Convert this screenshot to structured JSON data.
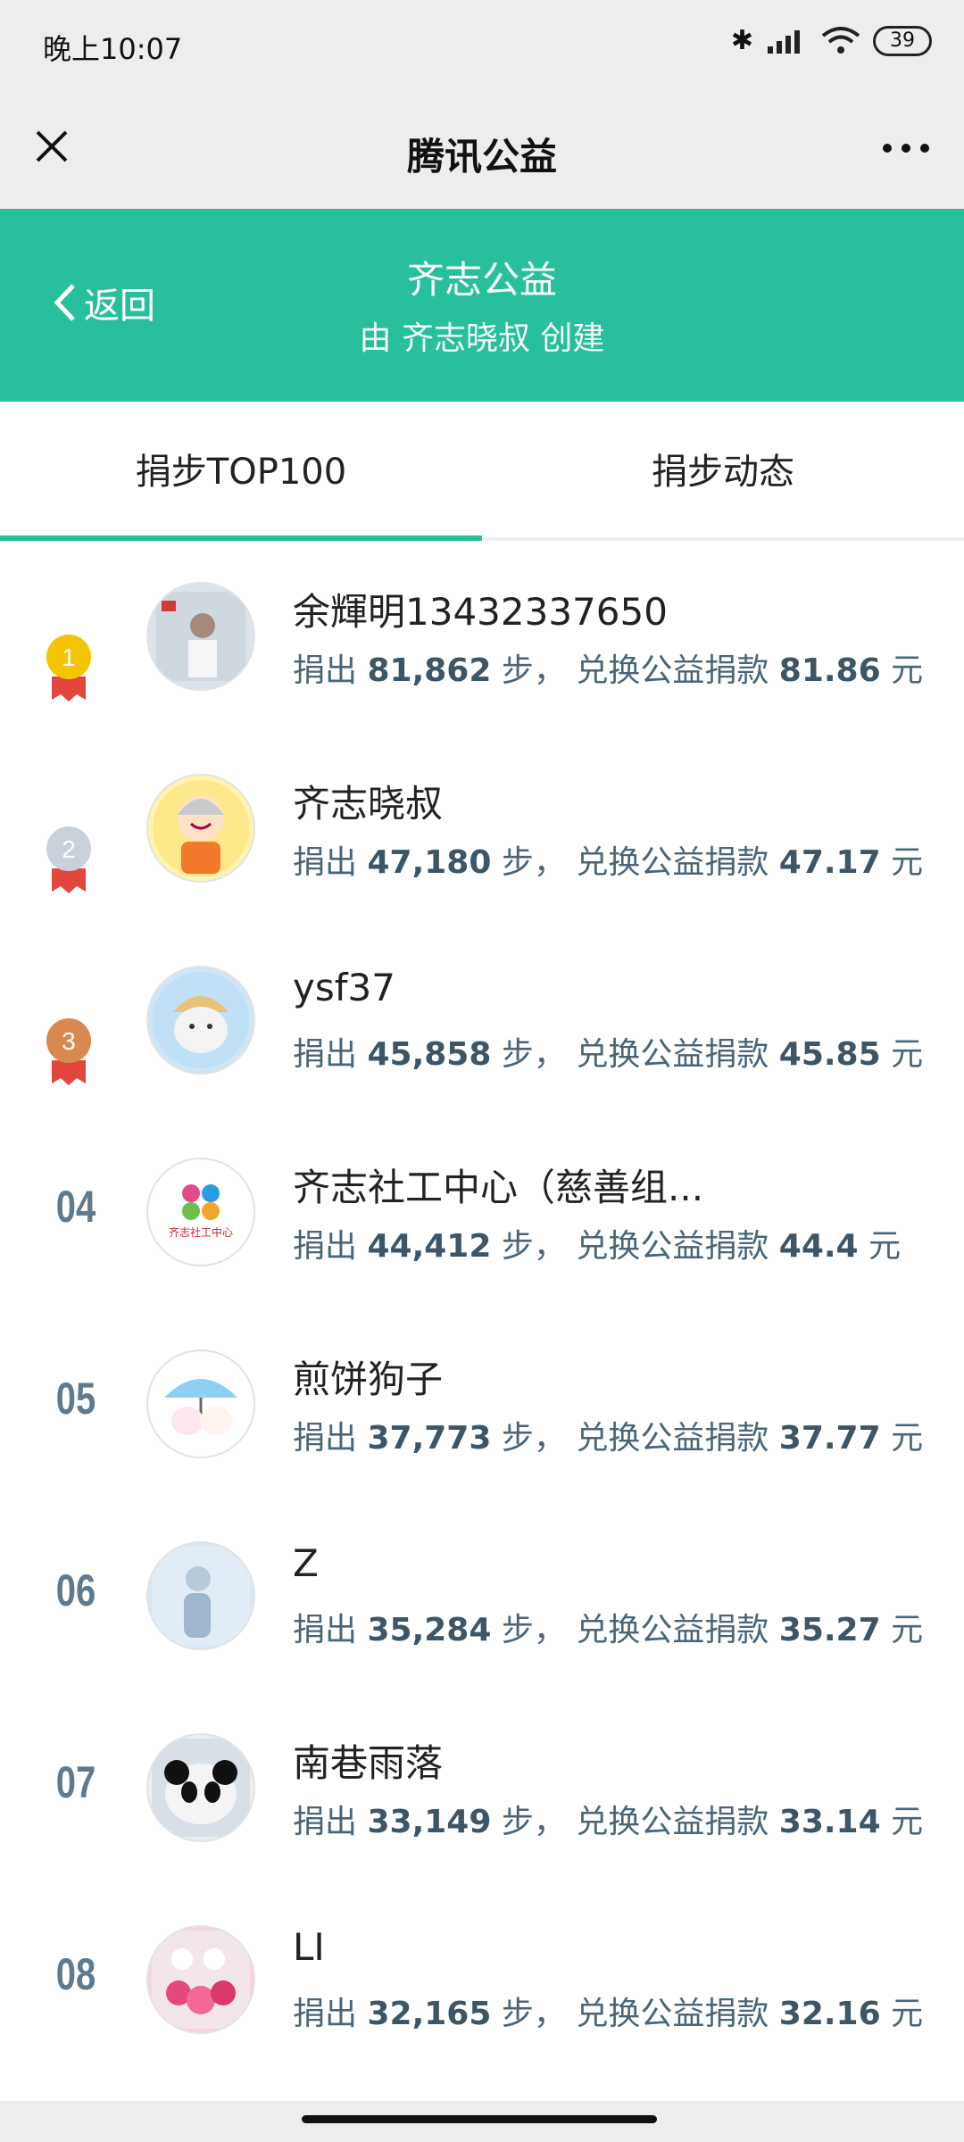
{
  "status": {
    "time": "晚上10:07",
    "battery": "39"
  },
  "titlebar": {
    "title": "腾讯公益"
  },
  "header": {
    "back_label": "返回",
    "org_name": "齐志公益",
    "creator": "由 齐志晓叔 创建"
  },
  "tabs": [
    {
      "label": "捐步TOP100",
      "active": true
    },
    {
      "label": "捐步动态",
      "active": false
    }
  ],
  "ranking": [
    {
      "rank": "1",
      "name": "余輝明13432337650",
      "steps": "81,862",
      "amount": "81.86"
    },
    {
      "rank": "2",
      "name": "齐志晓叔",
      "steps": "47,180",
      "amount": "47.17"
    },
    {
      "rank": "3",
      "name": "ysf37",
      "steps": "45,858",
      "amount": "45.85"
    },
    {
      "rank": "04",
      "name": "齐志社工中心（慈善组...",
      "steps": "44,412",
      "amount": "44.4"
    },
    {
      "rank": "05",
      "name": "煎饼狗子",
      "steps": "37,773",
      "amount": "37.77"
    },
    {
      "rank": "06",
      "name": "Z",
      "steps": "35,284",
      "amount": "35.27"
    },
    {
      "rank": "07",
      "name": "南巷雨落",
      "steps": "33,149",
      "amount": "33.14"
    },
    {
      "rank": "08",
      "name": "LI",
      "steps": "32,165",
      "amount": "32.16"
    }
  ],
  "labels": {
    "donated": "捐出",
    "steps_unit": "步，",
    "exchange": "兑换公益捐款",
    "currency": "元"
  },
  "avatar_text": {
    "qizhi_logo": "齐志社工中心"
  },
  "colors": {
    "accent": "#27bf9c",
    "gold": "#f5c400",
    "silver": "#c9d0dc",
    "bronze": "#d9894f",
    "ribbon": "#e2463c"
  }
}
